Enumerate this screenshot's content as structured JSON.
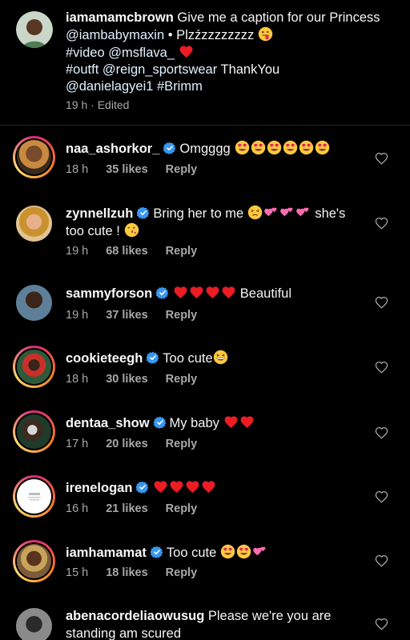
{
  "post_caption": {
    "username": "iamamamcbrown",
    "text_a": "Give me a caption for our Princess ",
    "mention_1": "@iambabymaxin",
    "text_b": " • Plzźzzzzzzzz",
    "line2_tag": "#video",
    "line2_mention": "@msflava_",
    "line3_tag": "#outft",
    "line3_mention": "@reign_sportswear",
    "line3_text": " ThankYou",
    "line4_mention": "@danielagyei1",
    "line4_tag": " #Brimm",
    "time": "19 h",
    "edited": "Edited"
  },
  "reply_label": "Reply",
  "comments": [
    {
      "username": "naa_ashorkor_",
      "text": "Omgggg",
      "time": "18 h",
      "likes": "35 likes"
    },
    {
      "username": "zynnellzuh",
      "text_a": "Bring her to me",
      "text_b": " she's",
      "text_c": "too cute !",
      "time": "19 h",
      "likes": "68 likes"
    },
    {
      "username": "sammyforson",
      "text": "Beautiful",
      "time": "19 h",
      "likes": "37 likes"
    },
    {
      "username": "cookieteegh",
      "text": "Too cute",
      "time": "18 h",
      "likes": "30 likes"
    },
    {
      "username": "dentaa_show",
      "text": "My baby",
      "time": "17 h",
      "likes": "20 likes"
    },
    {
      "username": "irenelogan",
      "text": "",
      "time": "16 h",
      "likes": "21 likes"
    },
    {
      "username": "iamhamamat",
      "text": "Too cute",
      "time": "15 h",
      "likes": "18 likes"
    },
    {
      "username": "abenacordeliaowusug",
      "text_a": "Please we're you are",
      "text_b": "standing am scured"
    }
  ],
  "icons": {
    "verified": "verified-badge-icon",
    "like": "heart-outline-icon",
    "emoji_heart_eyes": "heart-eyes-emoji",
    "emoji_heart": "red-heart-emoji",
    "emoji_two_hearts": "two-hearts-emoji"
  },
  "colors": {
    "background": "#000000",
    "text": "#f5f5f5",
    "muted": "#a8a8a8",
    "verified": "#3897f0",
    "heart": "#ed1c24",
    "emoji_yellow": "#ffc83d"
  }
}
